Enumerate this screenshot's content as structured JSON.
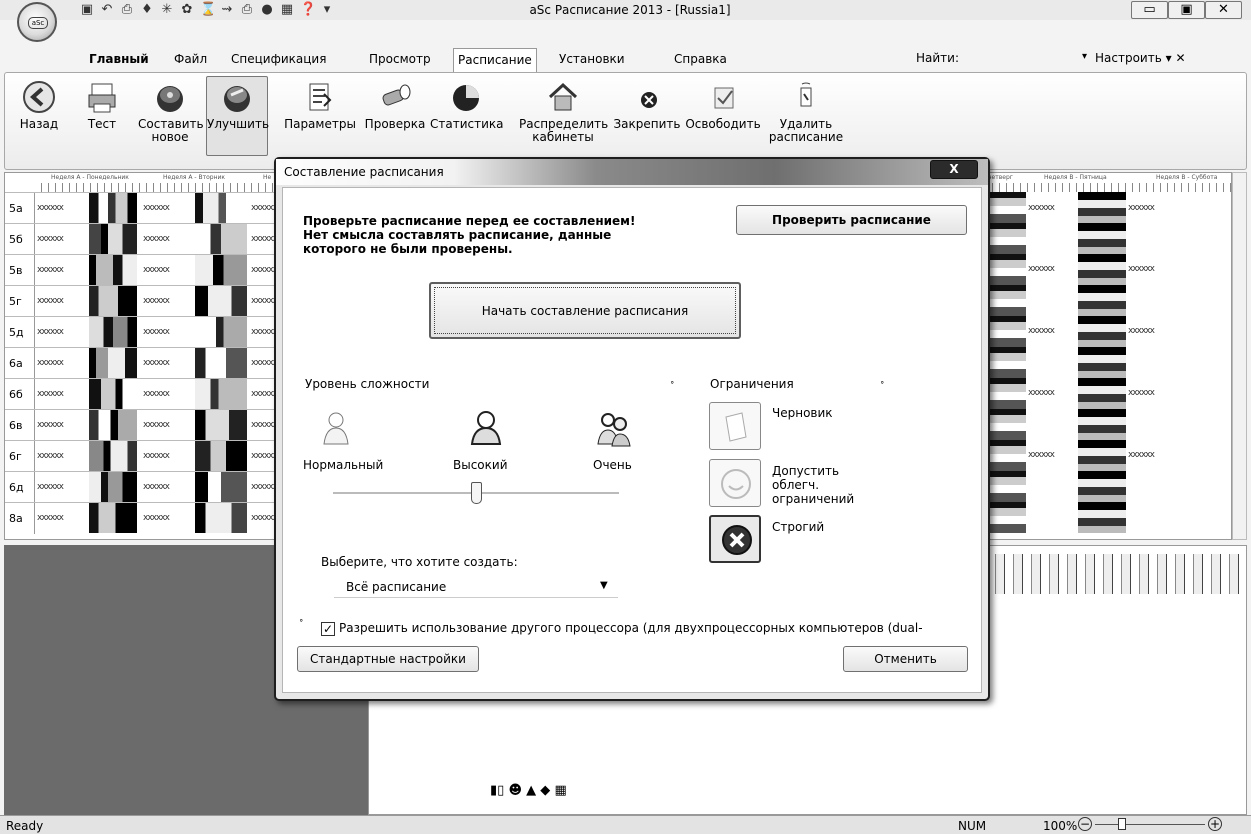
{
  "window": {
    "title": "aSc Расписание 2013  - [Russia1]",
    "orb_label": "aSc",
    "minimize": "▭",
    "maximize": "▣",
    "close": "✕"
  },
  "tabs": [
    "Главный",
    "Файл",
    "Спецификация",
    "Просмотр",
    "Расписание",
    "Установки",
    "Справка"
  ],
  "active_tab": "Расписание",
  "find_label": "Найти:",
  "customize_label": "Настроить",
  "ribbon": {
    "back": "Назад",
    "test": "Тест",
    "compose_new_1": "Составить",
    "compose_new_2": "новое",
    "improve": "Улучшить",
    "params": "Параметры",
    "check": "Проверка",
    "stats": "Статистика",
    "distribute_1": "Распределить",
    "distribute_2": "кабинеты",
    "pin": "Закрепить",
    "release": "Освободить",
    "delete_1": "Удалить",
    "delete_2": "расписание"
  },
  "timetable": {
    "day_headers": [
      "Неделя А - Понедельник",
      "Неделя А - Вторник",
      "Не"
    ],
    "day_headers_right": [
      "четверг",
      "Неделя В - Пятница",
      "Неделя В - Суббота"
    ],
    "classes": [
      "5а",
      "5б",
      "5в",
      "5г",
      "5д",
      "6а",
      "6б",
      "6в",
      "6г",
      "6д",
      "8а"
    ],
    "x_marks": "xxxxxx"
  },
  "status": {
    "ready": "Ready",
    "num": "NUM",
    "zoom": "100%"
  },
  "dialog": {
    "title": "Составление расписания",
    "close": "X",
    "warning_1": "Проверьте расписание перед ее составлением!",
    "warning_2": "Нет смысла составлять расписание, данные",
    "warning_3": "которого не были проверены.",
    "check_button": "Проверить расписание",
    "start_button": "Начать составление расписания",
    "level_label": "Уровень сложности",
    "levels": [
      "Нормальный",
      "Высокий",
      "Очень"
    ],
    "difficulty_fraction": 0.5,
    "limits_label": "Ограничения",
    "limits": [
      "Черновик",
      "Допустить",
      "облегч.",
      "ограничений",
      "Строгий"
    ],
    "create_label": "Выберите, что хотите создать:",
    "create_value": "Всё расписание",
    "dual_cpu_checked": true,
    "dual_cpu_label": "Разрешить использование другого процессора (для двухпроцессорных компьютеров (dual-",
    "defaults_button": "Стандартные настройки",
    "cancel_button": "Отменить"
  }
}
